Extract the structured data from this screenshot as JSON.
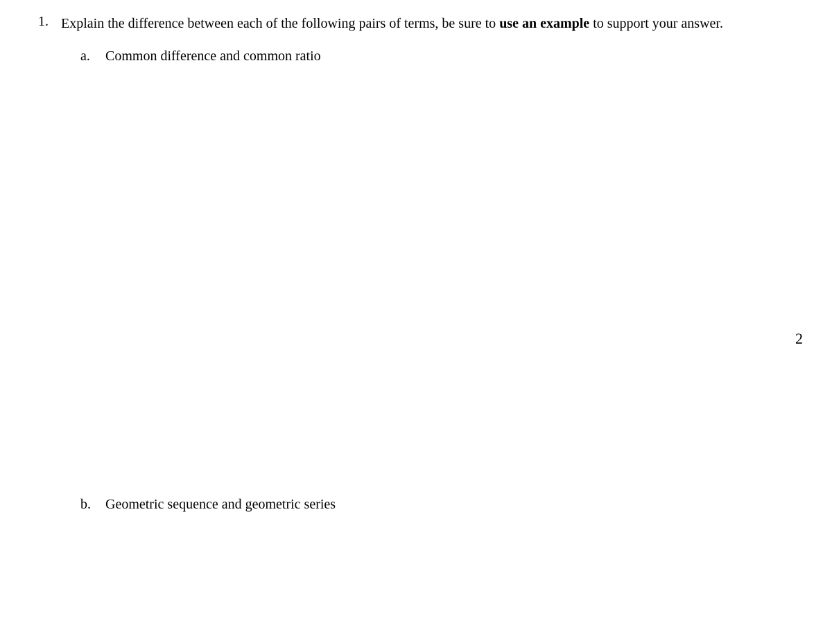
{
  "question": {
    "number": "1.",
    "text_part1": "Explain the difference between each of the following pairs of terms, be sure to ",
    "text_bold": "use an example",
    "text_part2": " to support your answer.",
    "subItems": [
      {
        "letter": "a.",
        "text": "Common difference and common ratio"
      },
      {
        "letter": "b.",
        "text": "Geometric sequence and geometric series"
      }
    ]
  },
  "marginMark": "2"
}
